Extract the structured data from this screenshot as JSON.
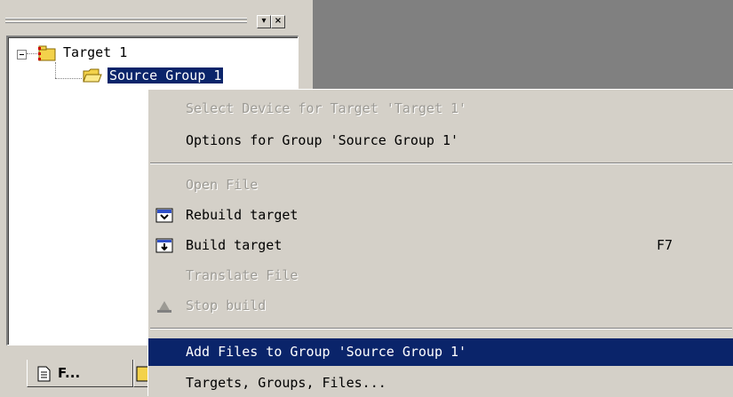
{
  "project_pane": {
    "tree": {
      "root_label": "Target 1",
      "child_label": "Source Group 1"
    },
    "tabs": [
      {
        "label": "F..."
      }
    ]
  },
  "context_menu": {
    "items": [
      {
        "label": "Select Device for Target 'Target 1'",
        "state": "disabled"
      },
      {
        "label": "Options for Group 'Source Group 1'",
        "state": "enabled"
      },
      {
        "label": "Open File",
        "state": "disabled"
      },
      {
        "label": "Rebuild target",
        "state": "enabled",
        "icon": "rebuild-icon"
      },
      {
        "label": "Build target",
        "state": "enabled",
        "icon": "build-icon",
        "shortcut": "F7"
      },
      {
        "label": "Translate File",
        "state": "disabled"
      },
      {
        "label": "Stop build",
        "state": "disabled",
        "icon": "stop-build-icon"
      },
      {
        "label": "Add Files to Group 'Source Group 1'",
        "state": "highlighted"
      },
      {
        "label": "Targets, Groups, Files...",
        "state": "enabled"
      }
    ]
  },
  "colors": {
    "face": "#d4d0c8",
    "workspace": "#808080",
    "highlight": "#0a246a",
    "disabled_text": "#9c9a94"
  }
}
